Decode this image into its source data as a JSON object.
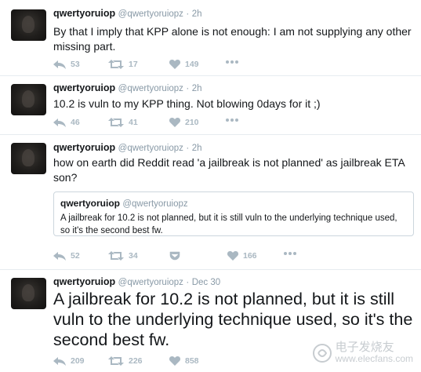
{
  "tweets": [
    {
      "name": "qwertyoruiop",
      "handle": "@qwertyoruiopz",
      "time": "2h",
      "text": "By that I imply that KPP alone is not enough: I am not supplying any other missing part.",
      "replies": "53",
      "retweets": "17",
      "likes": "149"
    },
    {
      "name": "qwertyoruiop",
      "handle": "@qwertyoruiopz",
      "time": "2h",
      "text": "10.2 is vuln to my KPP thing. Not blowing 0days for it ;)",
      "replies": "46",
      "retweets": "41",
      "likes": "210"
    },
    {
      "name": "qwertyoruiop",
      "handle": "@qwertyoruiopz",
      "time": "2h",
      "text": "how on earth did Reddit read 'a jailbreak is not planned' as jailbreak ETA son?",
      "replies": "52",
      "retweets": "34",
      "likes": "166",
      "quote": {
        "name": "qwertyoruiop",
        "handle": "@qwertyoruiopz",
        "text": "A jailbreak for 10.2 is not planned, but it is still vuln to the underlying technique used, so it's the second best fw."
      }
    },
    {
      "name": "qwertyoruiop",
      "handle": "@qwertyoruiopz",
      "time": "Dec 30",
      "text": "A jailbreak for 10.2 is not planned, but it is still vuln to the underlying technique used, so it's the second best fw.",
      "replies": "209",
      "retweets": "226",
      "likes": "858"
    }
  ],
  "dot": "·",
  "watermark": {
    "line1": "电子发烧友",
    "line2": "www.elecfans.com"
  },
  "icons": {
    "reply": "reply-icon",
    "retweet": "retweet-icon",
    "like": "heart-icon",
    "more": "more-icon",
    "message": "direct-message-icon"
  },
  "colors": {
    "action_gray": "#aab8c2",
    "meta_gray": "#8899a6",
    "border": "#e6ecf0"
  }
}
